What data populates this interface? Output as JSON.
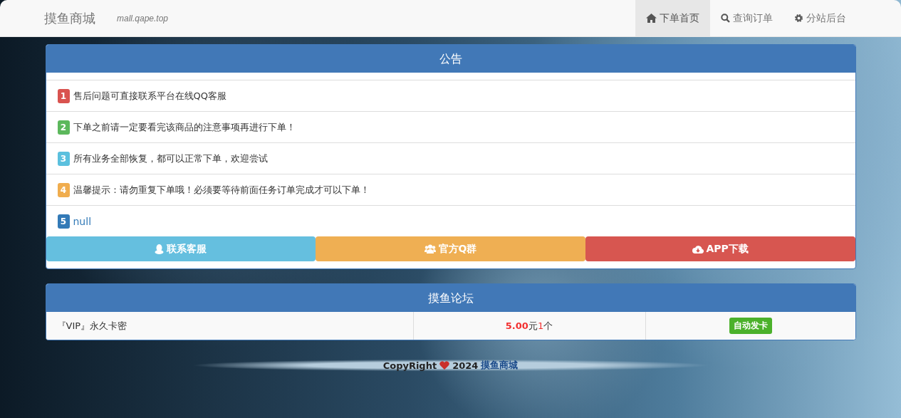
{
  "navbar": {
    "brand": "摸鱼商城",
    "domain": "mall.qape.top",
    "links": [
      {
        "label": "下单首页",
        "selected": true
      },
      {
        "label": "查询订单",
        "selected": false
      },
      {
        "label": "分站后台",
        "selected": false
      }
    ]
  },
  "notice": {
    "title": "公告",
    "items": [
      {
        "number": "1",
        "color": "#d9534f",
        "text": "售后问题可直接联系平台在线QQ客服",
        "kind": "text"
      },
      {
        "number": "2",
        "color": "#5cb85c",
        "text": "下单之前请一定要看完该商品的注意事项再进行下单！",
        "kind": "text"
      },
      {
        "number": "3",
        "color": "#5bc0de",
        "text": "所有业务全部恢复，都可以正常下单，欢迎尝试",
        "kind": "text"
      },
      {
        "number": "4",
        "color": "#f0ad4e",
        "text": "温馨提示：请勿重复下单哦！必须要等待前面任务订单完成才可以下单！",
        "kind": "text"
      },
      {
        "number": "5",
        "color": "#337ab7",
        "text": "null",
        "kind": "link"
      }
    ],
    "buttons": [
      {
        "label": "联系客服",
        "color": "#65bfdf"
      },
      {
        "label": "官方Q群",
        "color": "#efaf53"
      },
      {
        "label": "APP下载",
        "color": "#d75650"
      }
    ]
  },
  "forum": {
    "title": "摸鱼论坛",
    "rows": [
      {
        "name": "『VIP』永久卡密",
        "price": "5.00",
        "unit": "元",
        "qty": "1",
        "qty_unit": "个",
        "tag": "自动发卡"
      }
    ]
  },
  "footer": {
    "text": "CopyRight",
    "year": "2024",
    "link": "摸鱼商城"
  }
}
